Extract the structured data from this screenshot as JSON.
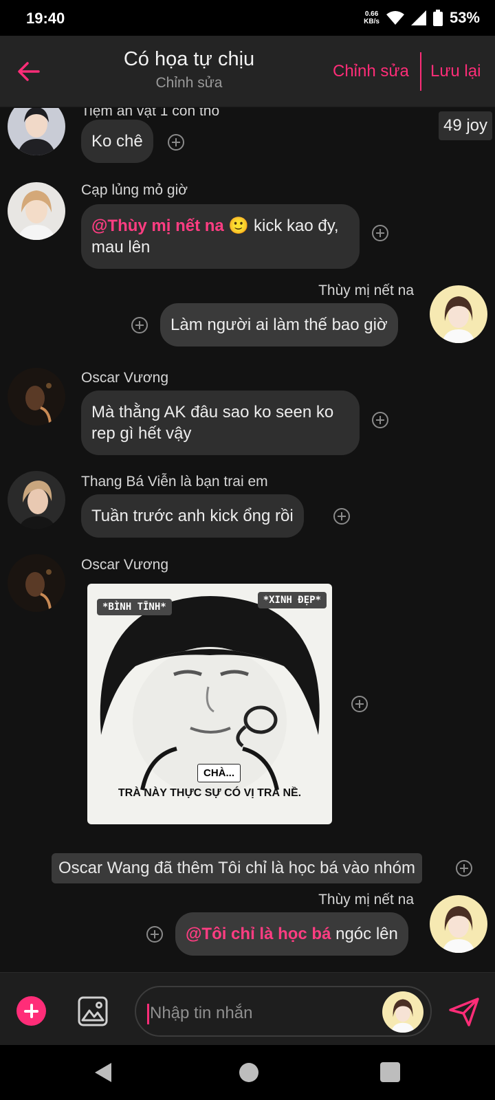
{
  "status_bar": {
    "time": "19:40",
    "net_speed_value": "0.66",
    "net_speed_unit": "KB/s",
    "battery": "53%"
  },
  "header": {
    "title": "Có họa tự chịu",
    "subtitle": "Chỉnh sửa",
    "edit_label": "Chỉnh sửa",
    "save_label": "Lưu lại"
  },
  "messages": [
    {
      "sender": "Tiệm ăn vặt 1 con thỏ",
      "text": "Ko chê"
    },
    {
      "sender": "Cạp lủng mỏ giờ",
      "mention": "@Thùy mị nết na",
      "emoji": "🙂",
      "text": " kick kao đy, mau lên"
    },
    {
      "sender": "Thùy mị nết na",
      "text": "Làm người ai làm thế bao giờ"
    },
    {
      "sender": "Oscar Vương",
      "text": "Mà thằng AK đâu sao ko seen ko rep gì hết vậy"
    },
    {
      "sender": "Thang Bá Viễn là bạn trai em",
      "text": "Tuần trước anh kick ổng rồi"
    },
    {
      "sender": "Oscar Vương",
      "sticker": {
        "tag_left": "*BÌNH TĨNH*",
        "tag_right": "*XINH ĐẸP*",
        "caption_1": "CHÀ...",
        "caption_2": "TRÀ NÀY THỰC SỰ CÓ VỊ TRÀ NỀ."
      }
    },
    {
      "sender": "Thùy mị nết na",
      "mention": "@Tôi chỉ là học bá",
      "text": " ngóc lên"
    }
  ],
  "joy_badge": "49 joy",
  "system_message": "Oscar Wang đã thêm Tôi chỉ là học bá vào nhóm",
  "composer": {
    "placeholder": "Nhập tin nhắn"
  },
  "colors": {
    "accent": "#ff2d78",
    "background": "#121212",
    "bubble": "#2f2f2f",
    "header": "#242424"
  },
  "icons": {
    "back": "arrow-left-icon",
    "react": "plus-circle-icon",
    "add": "plus-icon",
    "gallery": "image-icon",
    "send": "send-icon"
  }
}
